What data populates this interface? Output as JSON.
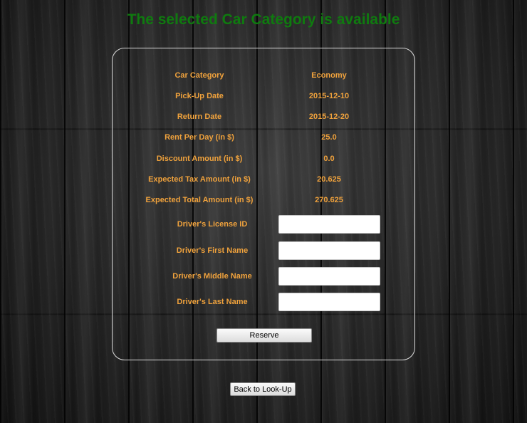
{
  "headline": "The selected Car Category is available",
  "summary": [
    {
      "label": "Car Category",
      "value": "Economy"
    },
    {
      "label": "Pick-Up Date",
      "value": "2015-12-10"
    },
    {
      "label": "Return Date",
      "value": "2015-12-20"
    },
    {
      "label": "Rent Per Day (in $)",
      "value": "25.0"
    },
    {
      "label": "Discount Amount (in $)",
      "value": "0.0"
    },
    {
      "label": "Expected Tax Amount (in $)",
      "value": "20.625"
    },
    {
      "label": "Expected Total Amount (in $)",
      "value": "270.625"
    }
  ],
  "fields": [
    {
      "label": "Driver's License ID",
      "value": ""
    },
    {
      "label": "Driver's First Name",
      "value": ""
    },
    {
      "label": "Driver's Middle Name",
      "value": ""
    },
    {
      "label": "Driver's Last Name",
      "value": ""
    }
  ],
  "buttons": {
    "reserve": "Reserve",
    "back": "Back to Look-Up"
  },
  "colors": {
    "headline": "#0f7a0f",
    "label": "#f0a23c",
    "panel_border": "#dcdcdc"
  }
}
